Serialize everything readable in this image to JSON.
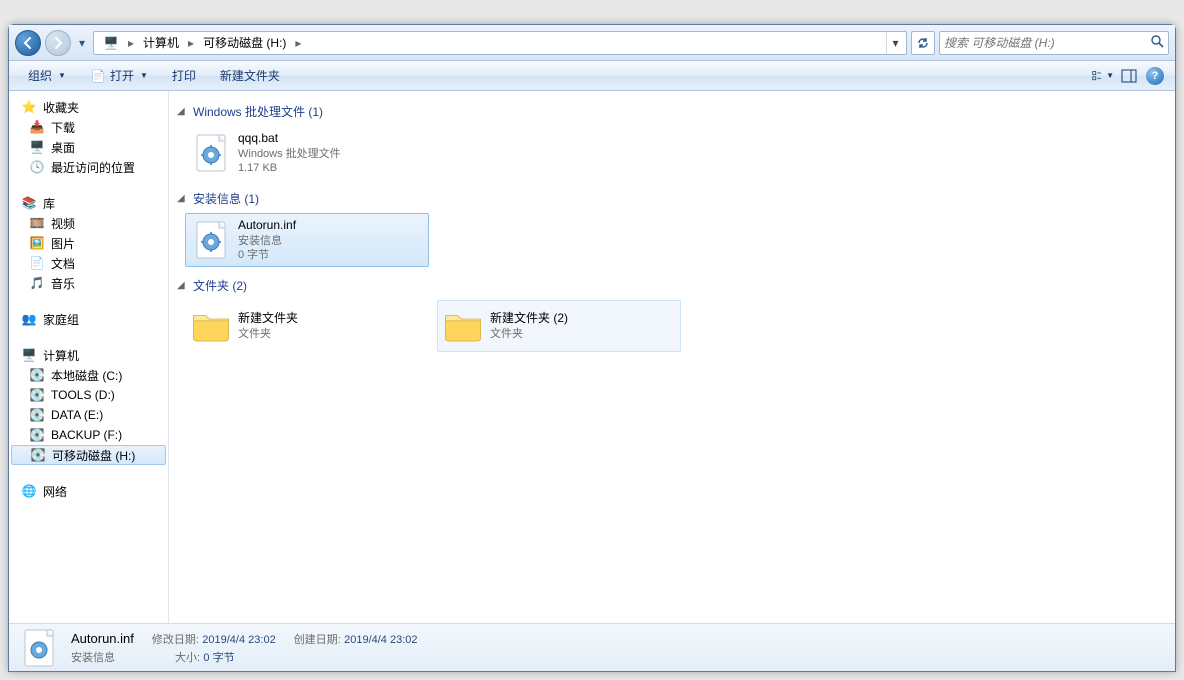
{
  "addr": {
    "crumbs": [
      "计算机",
      "可移动磁盘 (H:)"
    ],
    "search_ph": "搜索 可移动磁盘 (H:)"
  },
  "toolbar": {
    "org": "组织",
    "open": "打开",
    "print": "打印",
    "newf": "新建文件夹"
  },
  "tree": {
    "fav": {
      "label": "收藏夹",
      "items": [
        "下载",
        "桌面",
        "最近访问的位置"
      ]
    },
    "lib": {
      "label": "库",
      "items": [
        "视频",
        "图片",
        "文档",
        "音乐"
      ]
    },
    "home": "家庭组",
    "comp": {
      "label": "计算机",
      "items": [
        "本地磁盘 (C:)",
        "TOOLS (D:)",
        "DATA (E:)",
        "BACKUP (F:)",
        "可移动磁盘 (H:)"
      ]
    },
    "net": "网络"
  },
  "groups": [
    {
      "head": "Windows 批处理文件 (1)",
      "items": [
        {
          "name": "qqq.bat",
          "type": "Windows 批处理文件",
          "size": "1.17 KB",
          "icon": "gear"
        }
      ]
    },
    {
      "head": "安装信息 (1)",
      "items": [
        {
          "name": "Autorun.inf",
          "type": "安装信息",
          "size": "0 字节",
          "icon": "gear",
          "sel": true
        }
      ]
    },
    {
      "head": "文件夹 (2)",
      "items": [
        {
          "name": "新建文件夹",
          "type": "文件夹",
          "icon": "folder"
        },
        {
          "name": "新建文件夹 (2)",
          "type": "文件夹",
          "icon": "folder",
          "hov": true
        }
      ]
    }
  ],
  "details": {
    "name": "Autorun.inf",
    "type": "安装信息",
    "mod_lab": "修改日期:",
    "mod_val": "2019/4/4 23:02",
    "cre_lab": "创建日期:",
    "cre_val": "2019/4/4 23:02",
    "size_lab": "大小:",
    "size_val": "0 字节"
  }
}
